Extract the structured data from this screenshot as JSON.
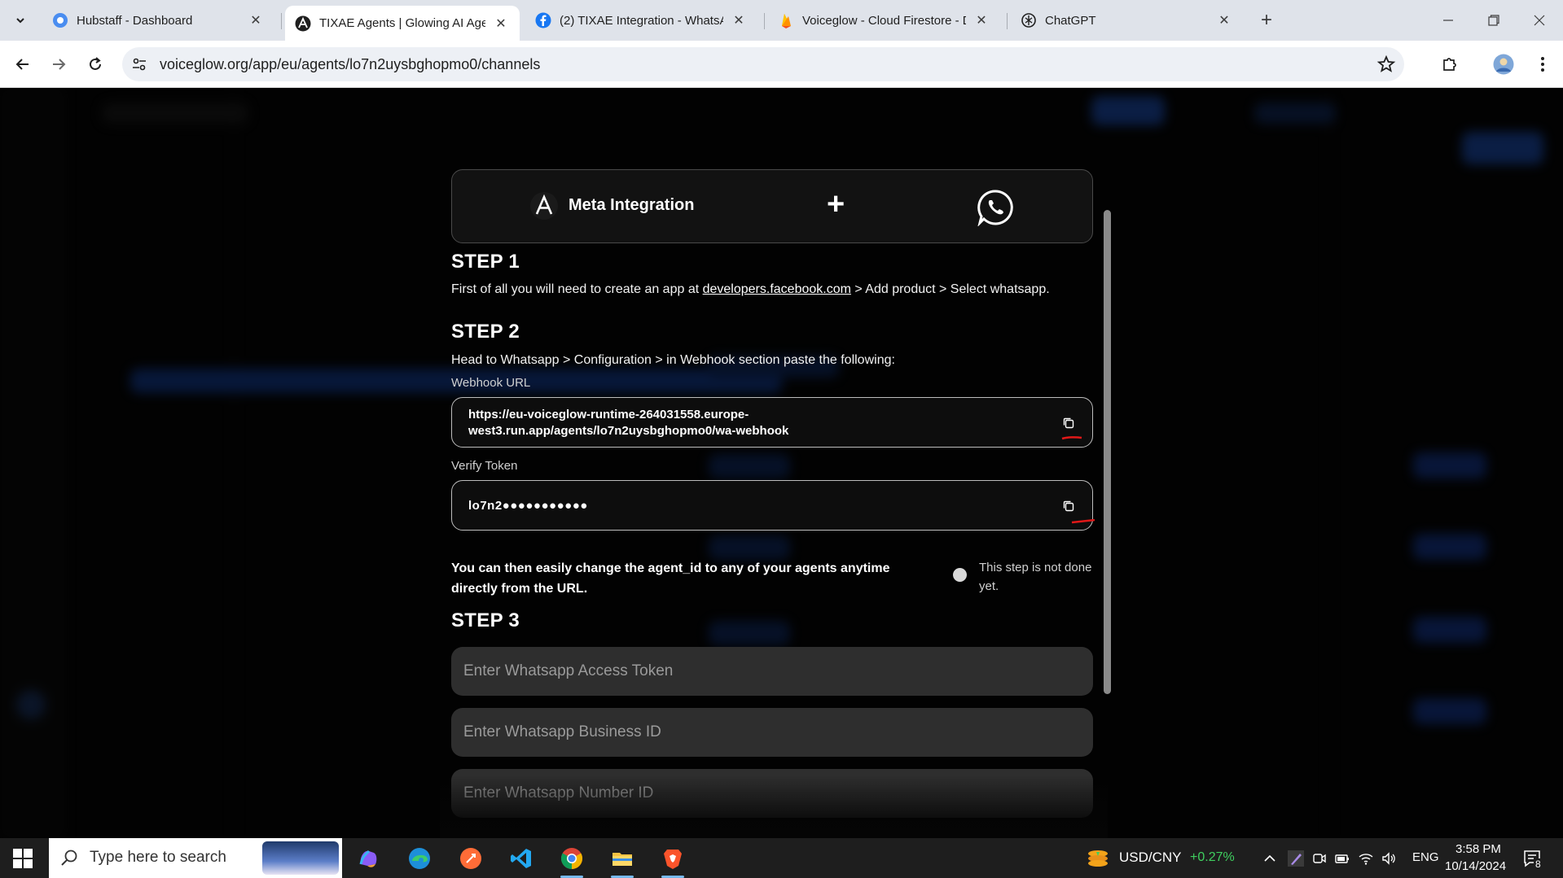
{
  "browser": {
    "tabs": [
      {
        "title": "Hubstaff - Dashboard",
        "icon": "hubstaff-icon",
        "active": false
      },
      {
        "title": "TIXAE Agents | Glowing AI Agen",
        "icon": "tixae-icon",
        "active": true
      },
      {
        "title": "(2) TIXAE Integration - WhatsAp",
        "icon": "facebook-icon",
        "active": false
      },
      {
        "title": "Voiceglow - Cloud Firestore - D",
        "icon": "firebase-icon",
        "active": false
      },
      {
        "title": "ChatGPT",
        "icon": "chatgpt-icon",
        "active": false
      }
    ],
    "url": "voiceglow.org/app/eu/agents/lo7n2uysbghopmo0/channels"
  },
  "modal": {
    "header": {
      "title": "Meta Integration",
      "plus": "+",
      "logo_icon": "tixae-logo-icon",
      "partner_icon": "whatsapp-icon"
    },
    "step1": {
      "title": "STEP 1",
      "text_before": "First of all you will need to create an app at ",
      "link": "developers.facebook.com",
      "text_after": " > Add product > Select whatsapp."
    },
    "step2": {
      "title": "STEP 2",
      "text": "Head to Whatsapp > Configuration > in Webhook section paste the following:",
      "webhook_label": "Webhook URL",
      "webhook_line1": "https://eu-voiceglow-runtime-264031558.europe-",
      "webhook_line2": "west3.run.app/agents/lo7n2uysbghopmo0/wa-webhook",
      "verify_label": "Verify Token",
      "verify_value": "lo7n2●●●●●●●●●●●",
      "note": "You can then easily change the agent_id to any of your agents anytime directly from the URL.",
      "status": "This step is not done yet."
    },
    "step3": {
      "title": "STEP 3",
      "access_token_placeholder": "Enter Whatsapp Access Token",
      "business_id_placeholder": "Enter Whatsapp Business ID",
      "number_id_placeholder": "Enter Whatsapp Number ID"
    }
  },
  "taskbar": {
    "search_placeholder": "Type here to search",
    "ticker": "USD/CNY",
    "ticker_change": "+0.27%",
    "language": "ENG",
    "time": "3:58 PM",
    "date": "10/14/2024",
    "notifications": "8"
  },
  "colors": {
    "ticker_up": "#3fcf5f",
    "annotation_red": "#e01818"
  }
}
